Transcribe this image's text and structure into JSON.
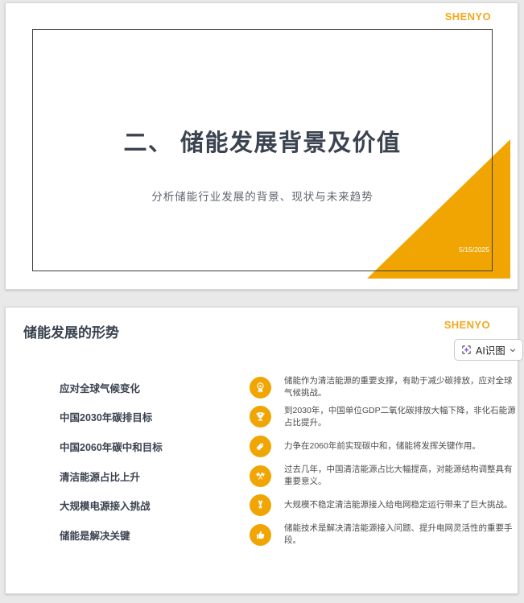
{
  "colors": {
    "accent": "#F0A502",
    "logo": "#F5A81C",
    "title": "#3B4350",
    "subtitle": "#5F6670",
    "desc": "#4D4D4D",
    "sparkle": "#8B5CF6",
    "page_background": "#E9E9E9"
  },
  "slide1": {
    "logo": "SHENYO",
    "title": "二、 储能发展背景及价值",
    "subtitle": "分析储能行业发展的背景、现状与未来趋势",
    "date": "5/15/2025"
  },
  "slide2": {
    "logo": "SHENYO",
    "title": "储能发展的形势",
    "ai_button": {
      "label": "AI识图"
    },
    "items": [
      {
        "heading": "应对全球气候变化",
        "icon": "award-ribbon-icon",
        "desc": "储能作为清洁能源的重要支撑，有助于减少碳排放，应对全球气候挑战。"
      },
      {
        "heading": "中国2030年碳排目标",
        "icon": "trophy-icon",
        "desc": "到2030年，中国单位GDP二氧化碳排放大幅下降，非化石能源占比提升。"
      },
      {
        "heading": "中国2060年碳中和目标",
        "icon": "tag-icon",
        "desc": "力争在2060年前实现碳中和，储能将发挥关键作用。"
      },
      {
        "heading": "清洁能源占比上升",
        "icon": "crossed-flags-icon",
        "desc": "过去几年，中国清洁能源占比大幅提高，对能源结构调整具有重要意义。"
      },
      {
        "heading": "大规模电源接入挑战",
        "icon": "medal-icon",
        "desc": "大规模不稳定清洁能源接入给电网稳定运行带来了巨大挑战。"
      },
      {
        "heading": "储能是解决关键",
        "icon": "thumbs-up-icon",
        "desc": "储能技术是解决清洁能源接入问题、提升电网灵活性的重要手段。"
      }
    ]
  }
}
